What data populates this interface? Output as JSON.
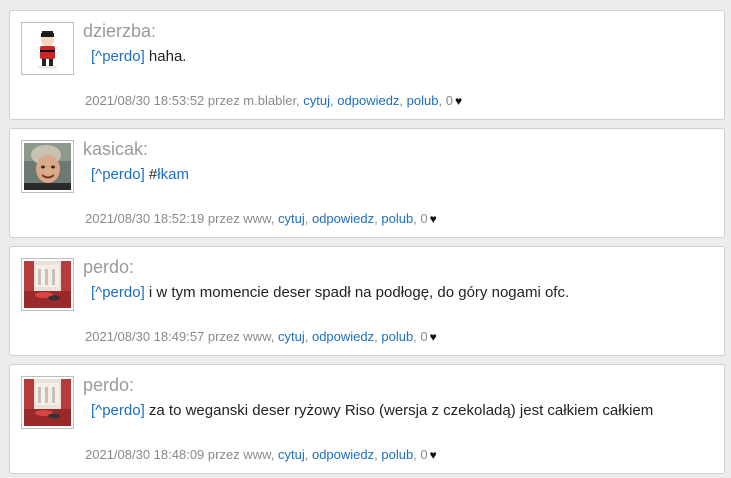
{
  "posts": [
    {
      "author": "dzierzba:",
      "reply_link": "[^perdo]",
      "text": " haha.",
      "tag": "",
      "timestamp": "2021/08/30 18:53:52",
      "via": "przez m.blabler,",
      "cite": "cytuj",
      "reply": "odpowiedz",
      "like": "polub",
      "likes": "0",
      "heart": "♥",
      "avatar_icon": "figure-doll-avatar"
    },
    {
      "author": "kasicak:",
      "reply_link": "[^perdo]",
      "text": " #",
      "tag": "łkam",
      "timestamp": "2021/08/30 18:52:19",
      "via": "przez www,",
      "cite": "cytuj",
      "reply": "odpowiedz",
      "like": "polub",
      "likes": "0",
      "heart": "♥",
      "avatar_icon": "person-photo-avatar"
    },
    {
      "author": "perdo:",
      "reply_link": "[^perdo]",
      "text": " i w tym momencie deser spadł na podłogę, do góry nogami ofc.",
      "tag": "",
      "timestamp": "2021/08/30 18:49:57",
      "via": "przez www,",
      "cite": "cytuj",
      "reply": "odpowiedz",
      "like": "polub",
      "likes": "0",
      "heart": "♥",
      "avatar_icon": "red-room-photo-avatar"
    },
    {
      "author": "perdo:",
      "reply_link": "[^perdo]",
      "text": " za to weganski deser ryżowy Riso (wersja z czekoladą) jest całkiem całkiem",
      "tag": "",
      "timestamp": "2021/08/30 18:48:09",
      "via": "przez www,",
      "cite": "cytuj",
      "reply": "odpowiedz",
      "like": "polub",
      "likes": "0",
      "heart": "♥",
      "avatar_icon": "red-room-photo-avatar"
    }
  ],
  "colors": {
    "link": "#1a6fc0",
    "author": "#9a9a9a",
    "meta": "#8a8a8a",
    "background": "#ececec"
  }
}
